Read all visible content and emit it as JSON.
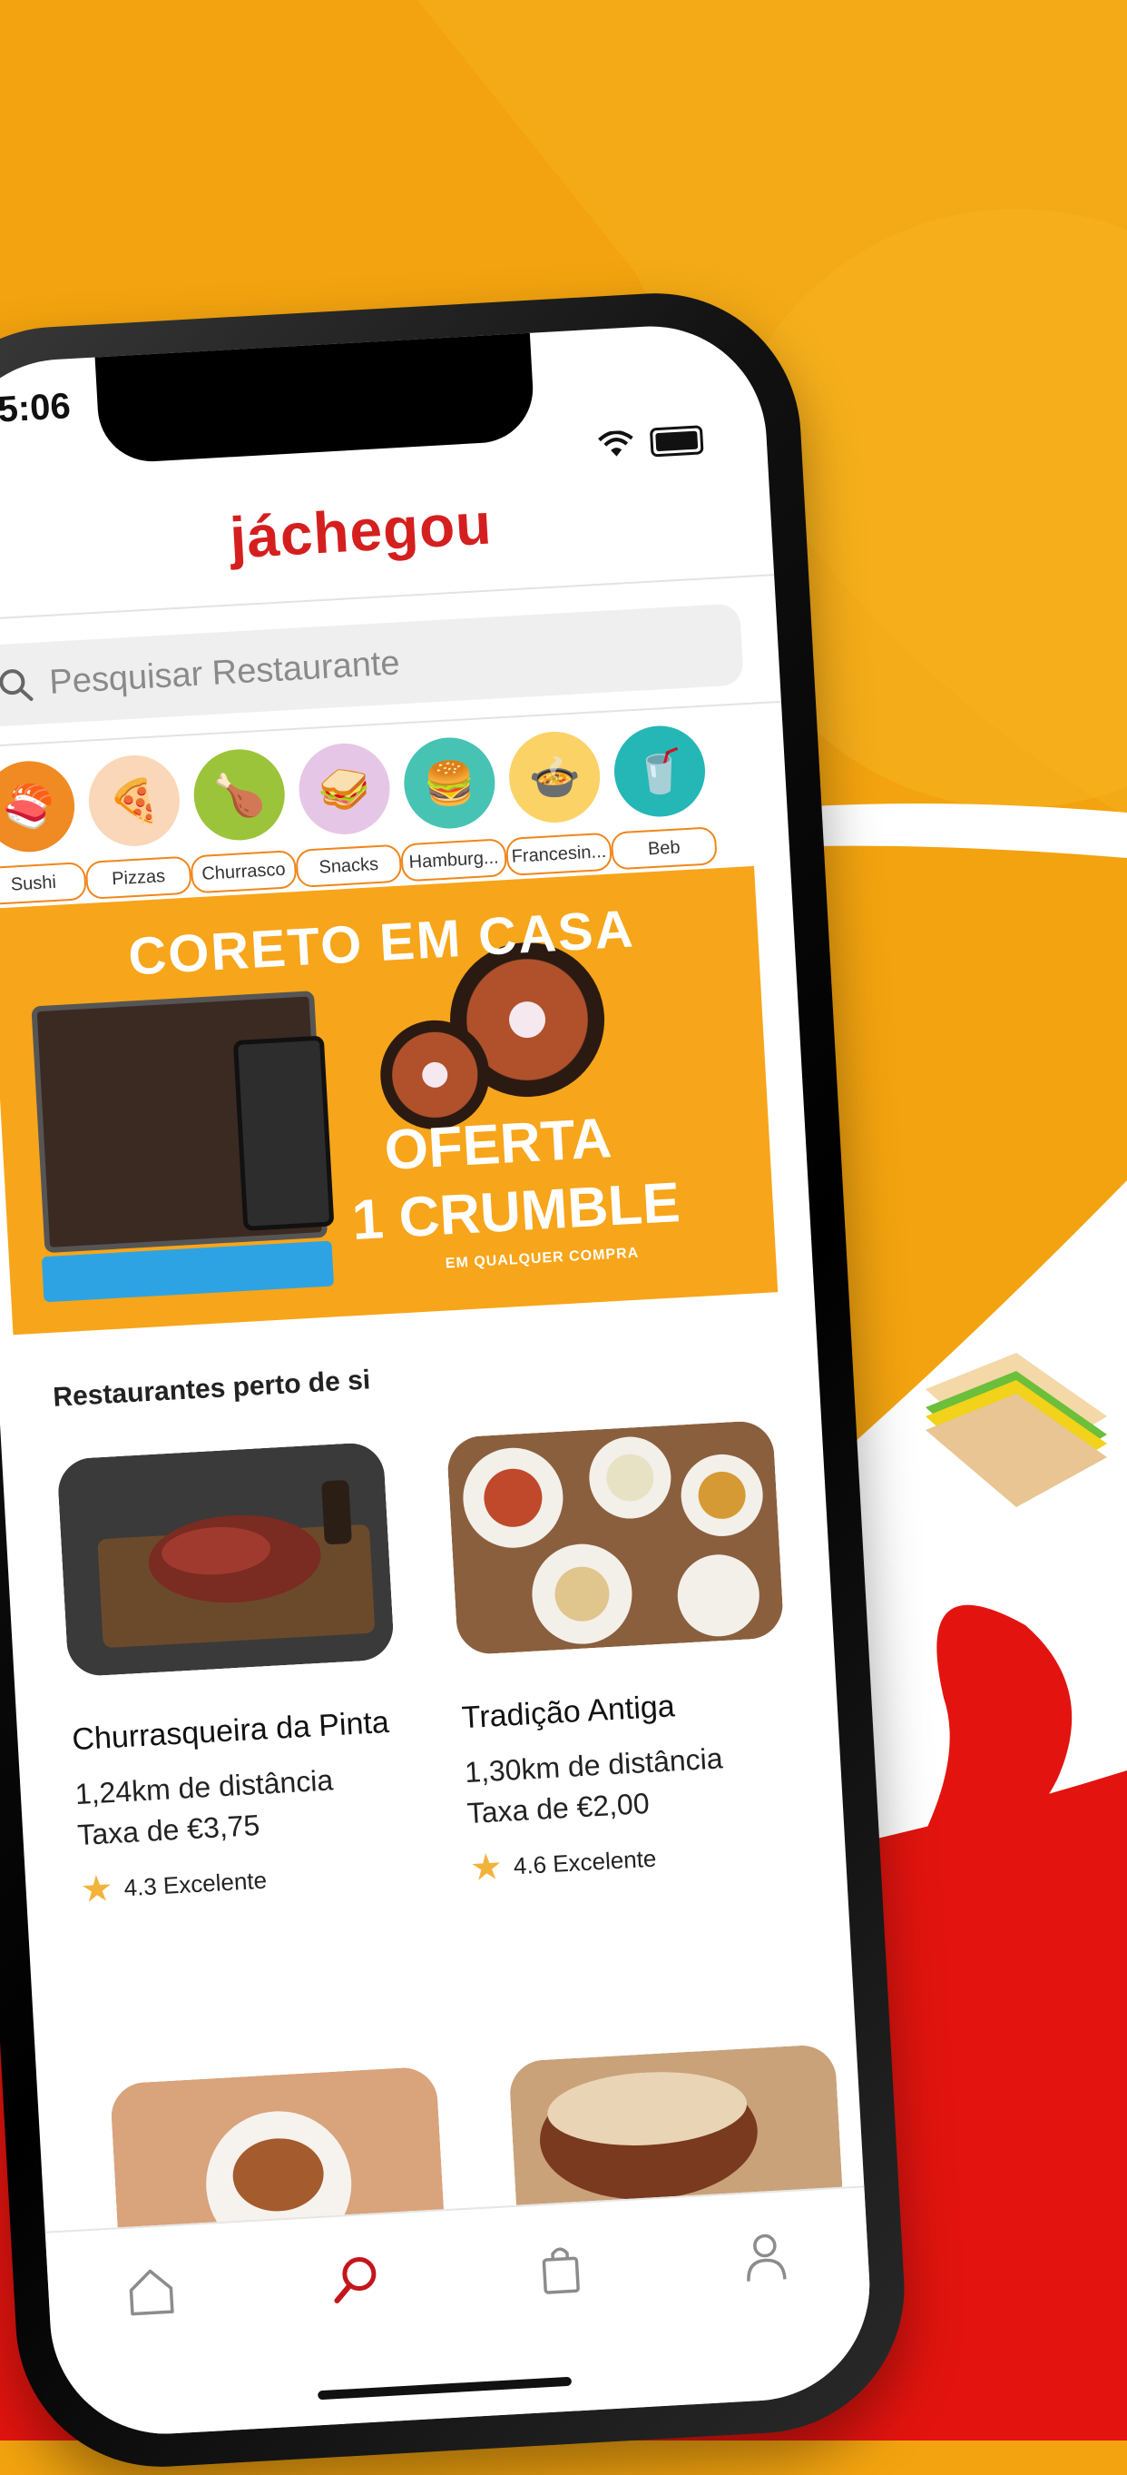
{
  "status": {
    "time": "5:06"
  },
  "app": {
    "logo": "jáchegou"
  },
  "search": {
    "placeholder": "Pesquisar Restaurante"
  },
  "categories": [
    {
      "label": "Sushi",
      "icon": "sushi-icon",
      "bg": "#f08a22",
      "glyph": "🍣"
    },
    {
      "label": "Pizzas",
      "icon": "pizza-icon",
      "bg": "#fad7b8",
      "glyph": "🍕"
    },
    {
      "label": "Churrasco",
      "icon": "drumstick-icon",
      "bg": "#9bc43a",
      "glyph": "🍗"
    },
    {
      "label": "Snacks",
      "icon": "sandwich-icon",
      "bg": "#e6c6e6",
      "glyph": "🥪"
    },
    {
      "label": "Hamburg...",
      "icon": "burger-icon",
      "bg": "#47c3b3",
      "glyph": "🍔"
    },
    {
      "label": "Francesin...",
      "icon": "francesinha-icon",
      "bg": "#fbd266",
      "glyph": "🍲"
    },
    {
      "label": "Beb",
      "icon": "drink-icon",
      "bg": "#25b7b6",
      "glyph": "🥤"
    }
  ],
  "banner": {
    "title": "CORETO EM CASA",
    "offer_line1": "OFERTA",
    "offer_line2": "1 CRUMBLE",
    "subtitle": "EM QUALQUER COMPRA"
  },
  "section": {
    "title": "Restaurantes perto de si"
  },
  "restaurants": [
    {
      "name": "Churrasqueira da Pinta",
      "distance": "1,24km de distância",
      "fee": "Taxa de €3,75",
      "rating": "4.3 Excelente"
    },
    {
      "name": "Tradição Antiga",
      "distance": "1,30km de distância",
      "fee": "Taxa de €2,00",
      "rating": "4.6 Excelente"
    }
  ],
  "tabs": [
    {
      "name": "home",
      "icon": "home-icon",
      "active": false
    },
    {
      "name": "search",
      "icon": "search-icon",
      "active": true
    },
    {
      "name": "orders",
      "icon": "bag-icon",
      "active": false
    },
    {
      "name": "profile",
      "icon": "user-icon",
      "active": false
    }
  ],
  "colors": {
    "brand": "#d51f1f",
    "accent": "#f2a30f",
    "active_tab": "#c3161c",
    "inactive_tab": "#8c8c8c"
  }
}
